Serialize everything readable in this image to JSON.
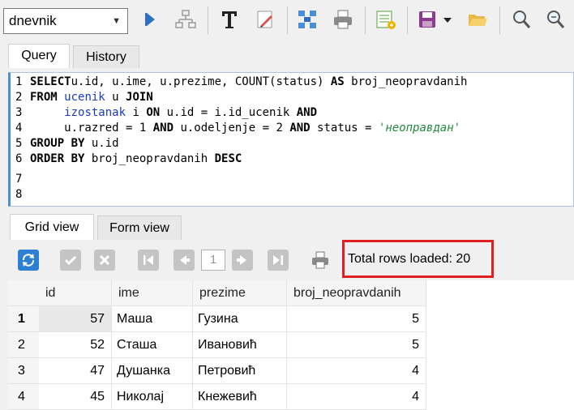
{
  "toolbar": {
    "database": "dnevnik",
    "buttons": [
      "execute-icon",
      "schema-icon",
      "format-text-icon",
      "edit-icon",
      "network-icon",
      "print-icon",
      "export-icon",
      "save-icon",
      "open-folder-icon",
      "zoom-in-icon",
      "zoom-out-icon"
    ]
  },
  "tabs": {
    "query": "Query",
    "history": "History"
  },
  "editor": {
    "line_numbers": [
      "1",
      "2",
      "3",
      "4",
      "5",
      "6",
      "7",
      "8"
    ],
    "lines": [
      {
        "parts": [
          [
            "kw",
            "SELECT"
          ],
          [
            "",
            "u.id, u.ime, u.prezime, COUNT(status) "
          ],
          [
            "kw",
            "AS"
          ],
          [
            "",
            " broj_neopravdanih"
          ]
        ]
      },
      {
        "parts": [
          [
            "kw",
            "FROM"
          ],
          [
            "",
            " "
          ],
          [
            "tbl",
            "ucenik"
          ],
          [
            "",
            " u "
          ],
          [
            "kw",
            "JOIN"
          ]
        ]
      },
      {
        "parts": [
          [
            "",
            "     "
          ],
          [
            "tbl",
            "izostanak"
          ],
          [
            "",
            " i "
          ],
          [
            "kw",
            "ON"
          ],
          [
            "",
            " u.id = i.id_ucenik "
          ],
          [
            "kw",
            "AND"
          ]
        ]
      },
      {
        "parts": [
          [
            "",
            "     u.razred = 1 "
          ],
          [
            "kw",
            "AND"
          ],
          [
            "",
            " u.odeljenje = 2 "
          ],
          [
            "kw",
            "AND"
          ],
          [
            "",
            " status = "
          ],
          [
            "str",
            "'неоправдан'"
          ]
        ]
      },
      {
        "parts": [
          [
            "kw",
            "GROUP BY"
          ],
          [
            "",
            " u.id"
          ]
        ]
      },
      {
        "parts": [
          [
            "kw",
            "ORDER BY"
          ],
          [
            "",
            " broj_neopravdanih "
          ],
          [
            "kw",
            "DESC"
          ]
        ]
      },
      {
        "parts": []
      },
      {
        "parts": []
      }
    ]
  },
  "result_tabs": {
    "grid": "Grid view",
    "form": "Form view"
  },
  "pager": {
    "page": "1",
    "total_rows_text": "Total rows loaded: 20"
  },
  "grid": {
    "columns": [
      "id",
      "ime",
      "prezime",
      "broj_neopravdanih"
    ],
    "rows": [
      {
        "n": "1",
        "cells": [
          "57",
          "Маша",
          "Гузина",
          "5"
        ]
      },
      {
        "n": "2",
        "cells": [
          "52",
          "Сташа",
          "Ивановић",
          "5"
        ]
      },
      {
        "n": "3",
        "cells": [
          "47",
          "Душанка",
          "Петровић",
          "4"
        ]
      },
      {
        "n": "4",
        "cells": [
          "45",
          "Николај",
          "Кнежевић",
          "4"
        ]
      }
    ]
  },
  "colors": {
    "highlight": "#e02020",
    "accent": "#4c8fd0",
    "keyword": "#000000",
    "table_name": "#1a3bbf",
    "string": "#1f8a3b"
  }
}
